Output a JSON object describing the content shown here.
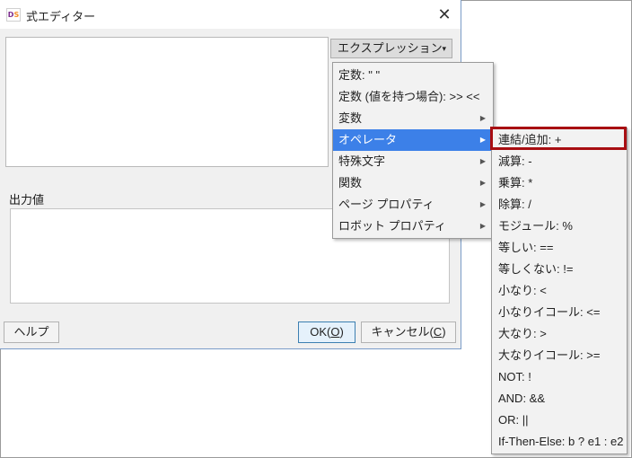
{
  "window": {
    "title": "式エディター",
    "icon_text_main": "D",
    "icon_text_accent": "S",
    "close_glyph": "✕"
  },
  "expression_button": {
    "label": "エクスプレッション",
    "caret": "▾"
  },
  "output": {
    "label": "出力値"
  },
  "buttons": {
    "help": "ヘルプ",
    "ok_prefix": "OK(",
    "ok_mnemonic": "O",
    "ok_suffix": ")",
    "cancel_prefix": "キャンセル(",
    "cancel_mnemonic": "C",
    "cancel_suffix": ")"
  },
  "menu": {
    "items": [
      {
        "label": "定数: \" \"",
        "has_submenu": false
      },
      {
        "label": "定数 (値を持つ場合): >> <<",
        "has_submenu": false
      },
      {
        "label": "変数",
        "has_submenu": true
      },
      {
        "label": "オペレータ",
        "has_submenu": true,
        "active": true
      },
      {
        "label": "特殊文字",
        "has_submenu": true
      },
      {
        "label": "関数",
        "has_submenu": true
      },
      {
        "label": "ページ プロパティ",
        "has_submenu": true
      },
      {
        "label": "ロボット プロパティ",
        "has_submenu": true
      }
    ],
    "submenu_arrow": "▶"
  },
  "operators_submenu": {
    "items": [
      "連結/追加: +",
      "減算: -",
      "乗算: *",
      "除算: /",
      "モジュール: %",
      "等しい: ==",
      "等しくない: !=",
      "小なり: <",
      "小なりイコール: <=",
      "大なり: >",
      "大なりイコール: >=",
      "NOT: !",
      "AND: &&",
      "OR: ||",
      "If-Then-Else: b ? e1 : e2"
    ],
    "highlighted_index": 0
  },
  "colors": {
    "menu_active": "#3c80e8",
    "highlight_border": "#a80e12",
    "ok_button_border": "#3c7fb1"
  }
}
